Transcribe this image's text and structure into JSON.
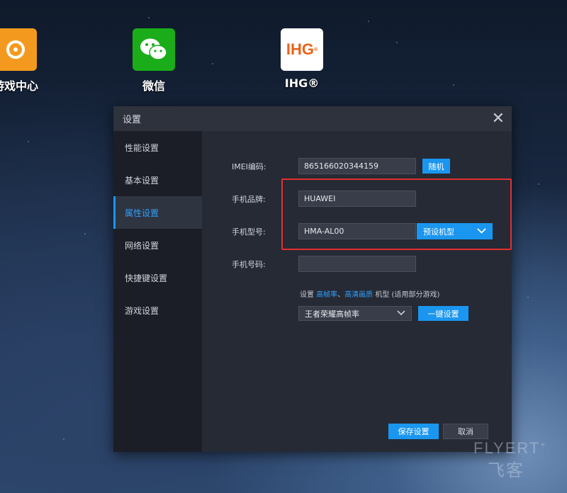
{
  "desktop": {
    "icons": [
      {
        "label": "游戏中心",
        "icon": "game-center-icon"
      },
      {
        "label": "微信",
        "icon": "wechat-icon"
      },
      {
        "label": "IHG®",
        "icon": "ihg-icon",
        "logo_text": "IHG"
      }
    ]
  },
  "dialog": {
    "title": "设置",
    "close_icon": "close-icon",
    "sidebar": [
      {
        "label": "性能设置",
        "active": false
      },
      {
        "label": "基本设置",
        "active": false
      },
      {
        "label": "属性设置",
        "active": true
      },
      {
        "label": "网络设置",
        "active": false
      },
      {
        "label": "快捷键设置",
        "active": false
      },
      {
        "label": "游戏设置",
        "active": false
      }
    ],
    "fields": {
      "imei_label": "IMEI编码:",
      "imei_value": "865166020344159",
      "random_button": "随机",
      "brand_label": "手机品牌:",
      "brand_value": "HUAWEI",
      "model_label": "手机型号:",
      "model_value": "HMA-AL00",
      "preset_label": "预设机型",
      "phone_label": "手机号码:",
      "phone_value": ""
    },
    "hint": {
      "prefix": "设置",
      "link1": "高帧率",
      "sep": "、",
      "link2": "高清画质",
      "suffix": "机型 (适用部分游戏)"
    },
    "game_select_value": "王者荣耀高帧率",
    "one_key_button": "一键设置",
    "save_button": "保存设置",
    "cancel_button": "取消"
  },
  "watermark": {
    "line1": "FLYERT",
    "line2": "飞客"
  },
  "colors": {
    "accent": "#1a96f0",
    "highlight_box": "#e23030"
  }
}
